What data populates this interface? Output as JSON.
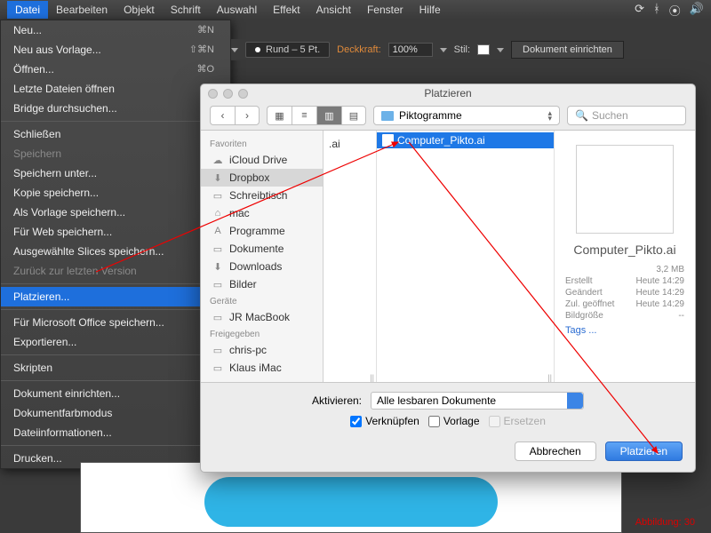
{
  "menubar": {
    "items": [
      "Datei",
      "Bearbeiten",
      "Objekt",
      "Schrift",
      "Auswahl",
      "Effekt",
      "Ansicht",
      "Fenster",
      "Hilfe"
    ]
  },
  "file_menu": {
    "groups": [
      [
        {
          "l": "Neu...",
          "s": "⌘N"
        },
        {
          "l": "Neu aus Vorlage...",
          "s": "⇧⌘N"
        },
        {
          "l": "Öffnen...",
          "s": "⌘O"
        },
        {
          "l": "Letzte Dateien öffnen",
          "s": "▶"
        },
        {
          "l": "Bridge durchsuchen...",
          "s": ""
        }
      ],
      [
        {
          "l": "Schließen",
          "s": ""
        },
        {
          "l": "Speichern",
          "s": "",
          "dis": true
        },
        {
          "l": "Speichern unter...",
          "s": ""
        },
        {
          "l": "Kopie speichern...",
          "s": ""
        },
        {
          "l": "Als Vorlage speichern...",
          "s": ""
        },
        {
          "l": "Für Web speichern...",
          "s": ""
        },
        {
          "l": "Ausgewählte Slices speichern...",
          "s": ""
        },
        {
          "l": "Zurück zur letzten Version",
          "s": "",
          "dis": true
        }
      ],
      [
        {
          "l": "Platzieren...",
          "s": "",
          "sel": true
        }
      ],
      [
        {
          "l": "Für Microsoft Office speichern...",
          "s": ""
        },
        {
          "l": "Exportieren...",
          "s": ""
        }
      ],
      [
        {
          "l": "Skripten",
          "s": ""
        }
      ],
      [
        {
          "l": "Dokument einrichten...",
          "s": ""
        },
        {
          "l": "Dokumentfarbmodus",
          "s": ""
        },
        {
          "l": "Dateiinformationen...",
          "s": ""
        }
      ],
      [
        {
          "l": "Drucken...",
          "s": ""
        }
      ]
    ]
  },
  "toolbar": {
    "stroke": "Rund – 5 Pt.",
    "opacity_label": "Deckkraft:",
    "opacity": "100%",
    "style_label": "Stil:",
    "setup": "Dokument einrichten"
  },
  "dialog": {
    "title": "Platzieren",
    "folder": "Piktogramme",
    "search_placeholder": "Suchen",
    "sidebar": {
      "favorites_head": "Favoriten",
      "favorites": [
        {
          "l": "iCloud Drive",
          "ic": "☁"
        },
        {
          "l": "Dropbox",
          "ic": "⬇",
          "sel": true
        },
        {
          "l": "Schreibtisch",
          "ic": "▭"
        },
        {
          "l": "mac",
          "ic": "⌂"
        },
        {
          "l": "Programme",
          "ic": "A"
        },
        {
          "l": "Dokumente",
          "ic": "▭"
        },
        {
          "l": "Downloads",
          "ic": "⬇"
        },
        {
          "l": "Bilder",
          "ic": "▭"
        }
      ],
      "devices_head": "Geräte",
      "devices": [
        {
          "l": "JR MacBook",
          "ic": "▭"
        }
      ],
      "shared_head": "Freigegeben",
      "shared": [
        {
          "l": "chris-pc",
          "ic": "▭"
        },
        {
          "l": "Klaus iMac",
          "ic": "▭"
        }
      ]
    },
    "col1": [
      " ",
      ".ai"
    ],
    "col2_selected": "Computer_Pikto.ai",
    "preview": {
      "name": "Computer_Pikto.ai",
      "size": "3,2 MB",
      "created_l": "Erstellt",
      "created_v": "Heute 14:29",
      "modified_l": "Geändert",
      "modified_v": "Heute 14:29",
      "opened_l": "Zul. geöffnet",
      "opened_v": "Heute 14:29",
      "dims_l": "Bildgröße",
      "dims_v": "--",
      "tags": "Tags ..."
    },
    "options": {
      "activate_l": "Aktivieren:",
      "activate_v": "Alle lesbaren Dokumente",
      "link": "Verknüpfen",
      "template": "Vorlage",
      "replace": "Ersetzen"
    },
    "cancel": "Abbrechen",
    "place": "Platzieren"
  },
  "caption": "Abbildung: 30"
}
